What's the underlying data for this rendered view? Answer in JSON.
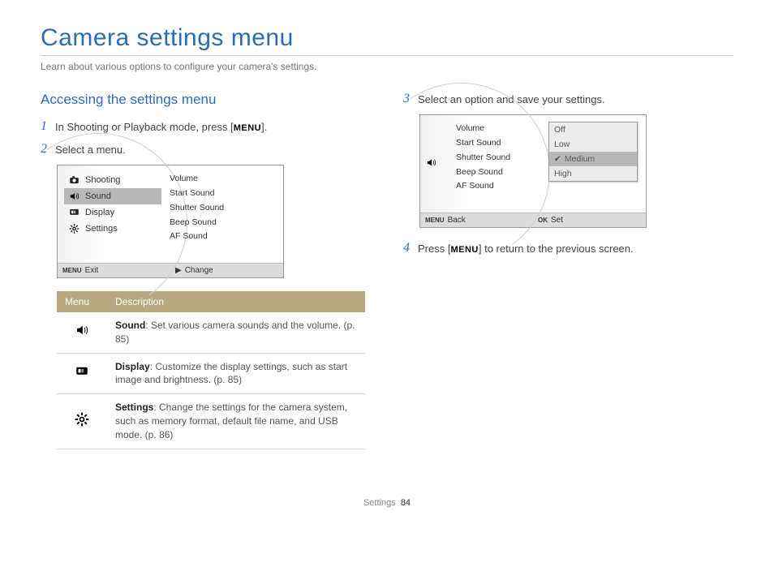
{
  "page": {
    "title": "Camera settings menu",
    "intro": "Learn about various options to configure your camera's settings.",
    "footer_label": "Settings",
    "footer_page": "84"
  },
  "section": {
    "heading": "Accessing the settings menu"
  },
  "steps": {
    "s1_num": "1",
    "s1_pre": "In Shooting or Playback mode, press [",
    "s1_key": "MENU",
    "s1_post": "].",
    "s2_num": "2",
    "s2_text": "Select a menu.",
    "s3_num": "3",
    "s3_text": "Select an option and save your settings.",
    "s4_num": "4",
    "s4_pre": "Press [",
    "s4_key": "MENU",
    "s4_post": "] to return to the previous screen."
  },
  "lcd1": {
    "left": {
      "i0": "Shooting",
      "i1": "Sound",
      "i2": "Display",
      "i3": "Settings"
    },
    "right": {
      "r0": "Volume",
      "r1": "Start Sound",
      "r2": "Shutter Sound",
      "r3": "Beep Sound",
      "r4": "AF Sound"
    },
    "footer_left_key": "MENU",
    "footer_left": "Exit",
    "footer_right_sym": "▶",
    "footer_right": "Change"
  },
  "lcd2": {
    "sub": {
      "s0": "Volume",
      "s1": "Start Sound",
      "s2": "Shutter Sound",
      "s3": "Beep Sound",
      "s4": "AF Sound"
    },
    "popup": {
      "p0": "Off",
      "p1": "Low",
      "p2_chk": "✔",
      "p2": "Medium",
      "p3": "High"
    },
    "footer_left_key": "MENU",
    "footer_left": "Back",
    "footer_right_key": "OK",
    "footer_right": "Set"
  },
  "table": {
    "h0": "Menu",
    "h1": "Description",
    "r0_label": "Sound",
    "r0_text": ": Set various camera sounds and the volume. (p. 85)",
    "r1_label": "Display",
    "r1_text": ": Customize the display settings, such as start image and brightness. (p. 85)",
    "r2_label": "Settings",
    "r2_text": ": Change the settings for the camera system, such as memory format, default file name, and USB mode. (p. 86)"
  }
}
